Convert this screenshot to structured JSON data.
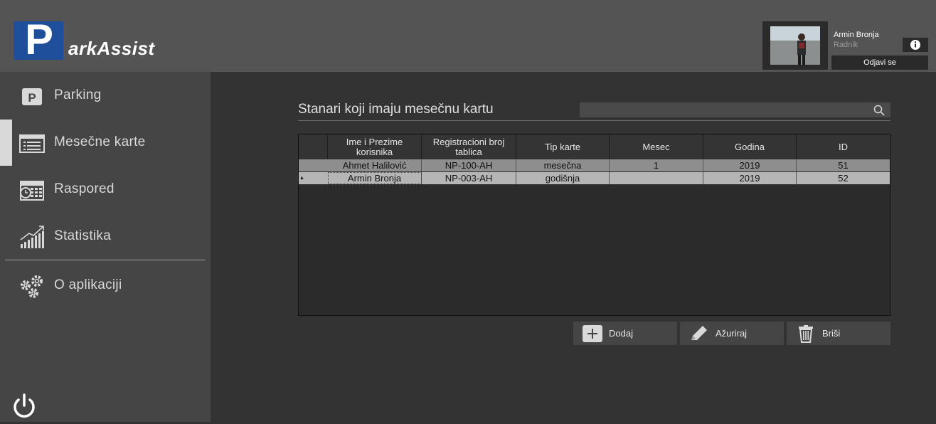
{
  "header": {
    "logo_letter": "P",
    "logo_rest": "arkAssist",
    "user_name": "Armin Bronja",
    "user_role": "Radnik",
    "logout_label": "Odjavi se"
  },
  "sidebar": {
    "items": [
      {
        "label": "Parking",
        "icon": "parking-icon"
      },
      {
        "label": "Mesečne karte",
        "icon": "list-icon",
        "active": true
      },
      {
        "label": "Raspored",
        "icon": "calendar-icon"
      },
      {
        "label": "Statistika",
        "icon": "chart-icon"
      },
      {
        "label": "O aplikaciji",
        "icon": "gears-icon"
      }
    ]
  },
  "main": {
    "title": "Stanari koji imaju mesečnu kartu",
    "search": {
      "value": "",
      "placeholder": ""
    },
    "table": {
      "columns": [
        "Ime i Prezime korisnika",
        "Registracioni broj tablica",
        "Tip karte",
        "Mesec",
        "Godina",
        "ID"
      ],
      "rows": [
        [
          "Ahmet Halilović",
          "NP-100-AH",
          "mesečna",
          "1",
          "2019",
          "51"
        ],
        [
          "Armin Bronja",
          "NP-003-AH",
          "godišnja",
          "",
          "2019",
          "52"
        ]
      ],
      "selected_row": 1
    },
    "buttons": {
      "add": "Dodaj",
      "update": "Ažuriraj",
      "delete": "Briši"
    }
  },
  "colors": {
    "logo_blue": "#1f4e9a",
    "header_bg": "#545454",
    "sidebar_bg": "#454545",
    "main_bg": "#333333"
  }
}
